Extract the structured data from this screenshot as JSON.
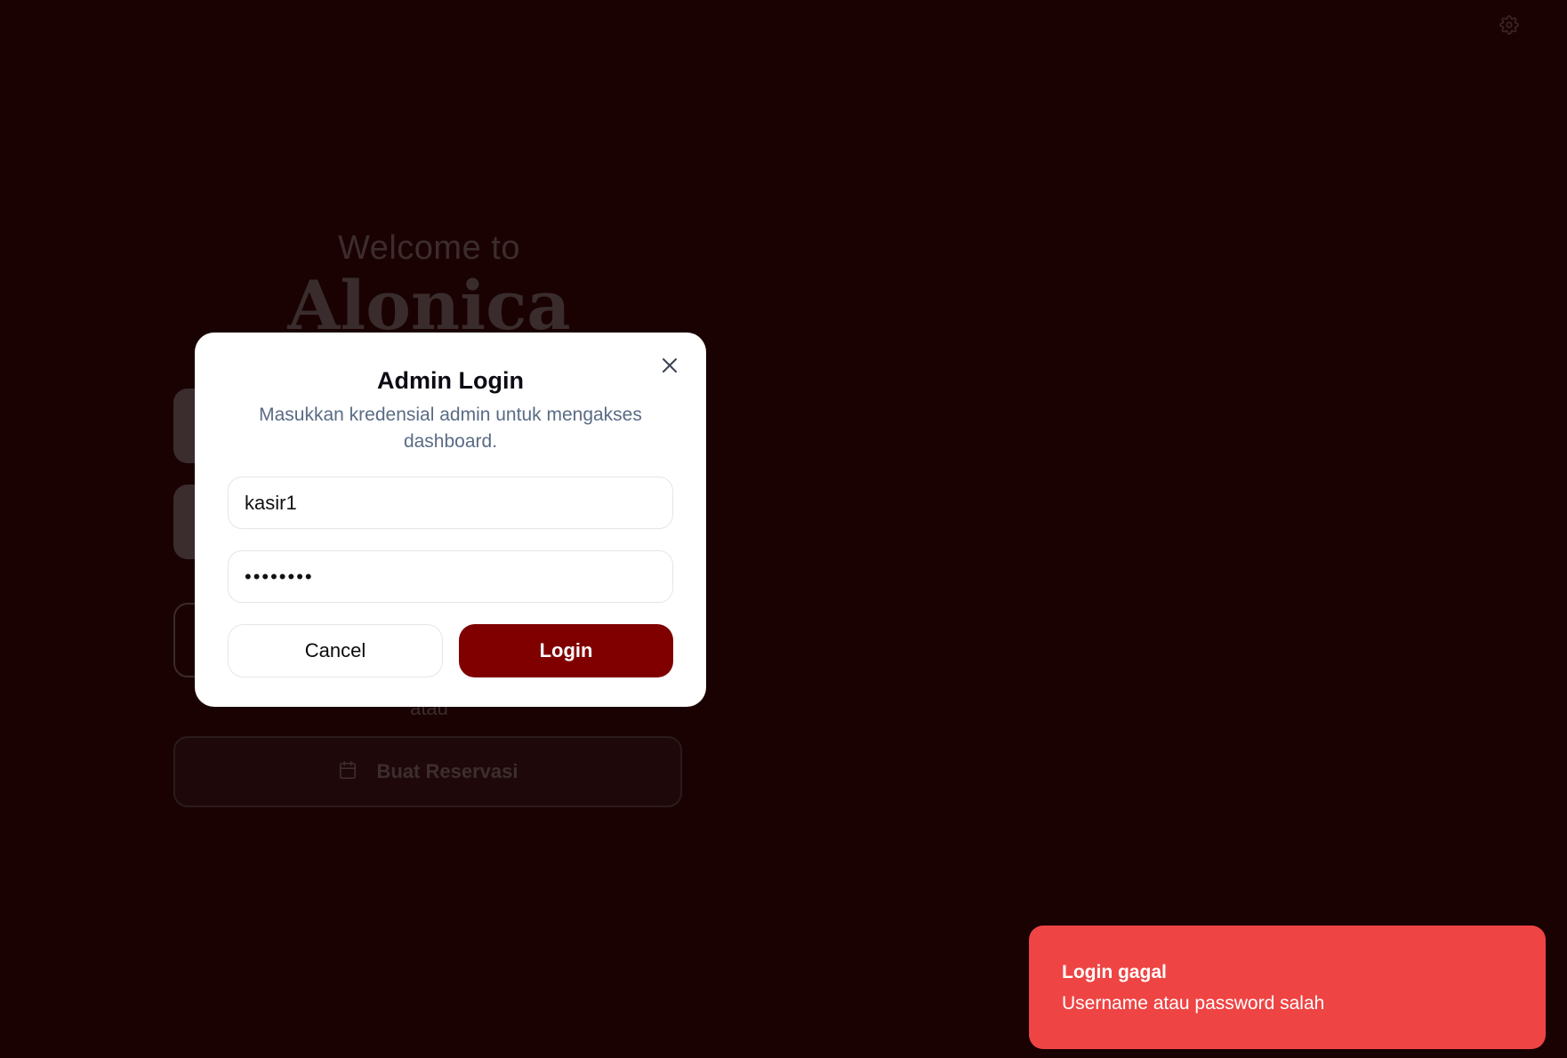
{
  "background": {
    "welcome_text": "Welcome to",
    "brand_name": "Alonica",
    "separator_text": "atau",
    "reservation_button_label": "Buat Reservasi",
    "reservation_icon": "calendar-icon",
    "settings_icon": "gear-icon"
  },
  "modal": {
    "title": "Admin Login",
    "description": "Masukkan kredensial admin untuk mengakses dashboard.",
    "close_icon": "close-icon",
    "username_value": "kasir1",
    "password_value": "••••••••",
    "cancel_label": "Cancel",
    "login_label": "Login"
  },
  "toast": {
    "title": "Login gagal",
    "message": "Username atau password salah"
  },
  "colors": {
    "page_background": "#1a0203",
    "primary_button": "#800000",
    "toast_error": "#ef4444",
    "modal_background": "#ffffff",
    "description_text": "#5a6b85"
  }
}
